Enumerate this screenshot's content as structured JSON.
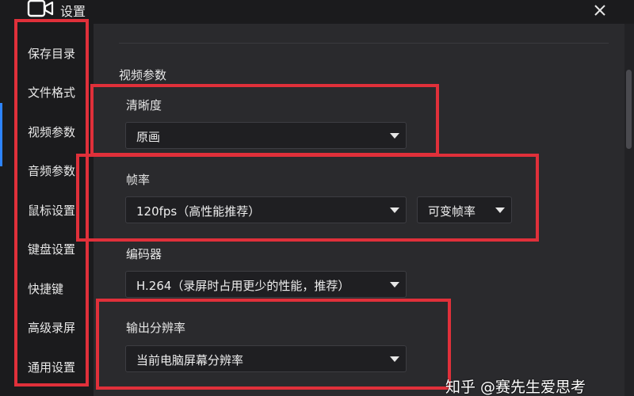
{
  "window": {
    "title": "设置"
  },
  "sidebar": {
    "items": [
      {
        "label": "保存目录"
      },
      {
        "label": "文件格式"
      },
      {
        "label": "视频参数"
      },
      {
        "label": "音频参数"
      },
      {
        "label": "鼠标设置"
      },
      {
        "label": "键盘设置"
      },
      {
        "label": "快捷键"
      },
      {
        "label": "高级录屏"
      },
      {
        "label": "通用设置"
      }
    ]
  },
  "main": {
    "section_title": "视频参数",
    "clarity": {
      "label": "清晰度",
      "value": "原画"
    },
    "frame_rate": {
      "label": "帧率",
      "value": "120fps（高性能推荐）",
      "mode": "可变帧率"
    },
    "encoder": {
      "label": "编码器",
      "value": "H.264（录屏时占用更少的性能，推荐）"
    },
    "resolution": {
      "label": "输出分辨率",
      "value": "当前电脑屏幕分辨率"
    }
  },
  "watermark": "知乎 @赛先生爱思考",
  "colors": {
    "highlight": "#e0303a",
    "accent": "#2d84ff",
    "background": "#2a2a2d"
  }
}
